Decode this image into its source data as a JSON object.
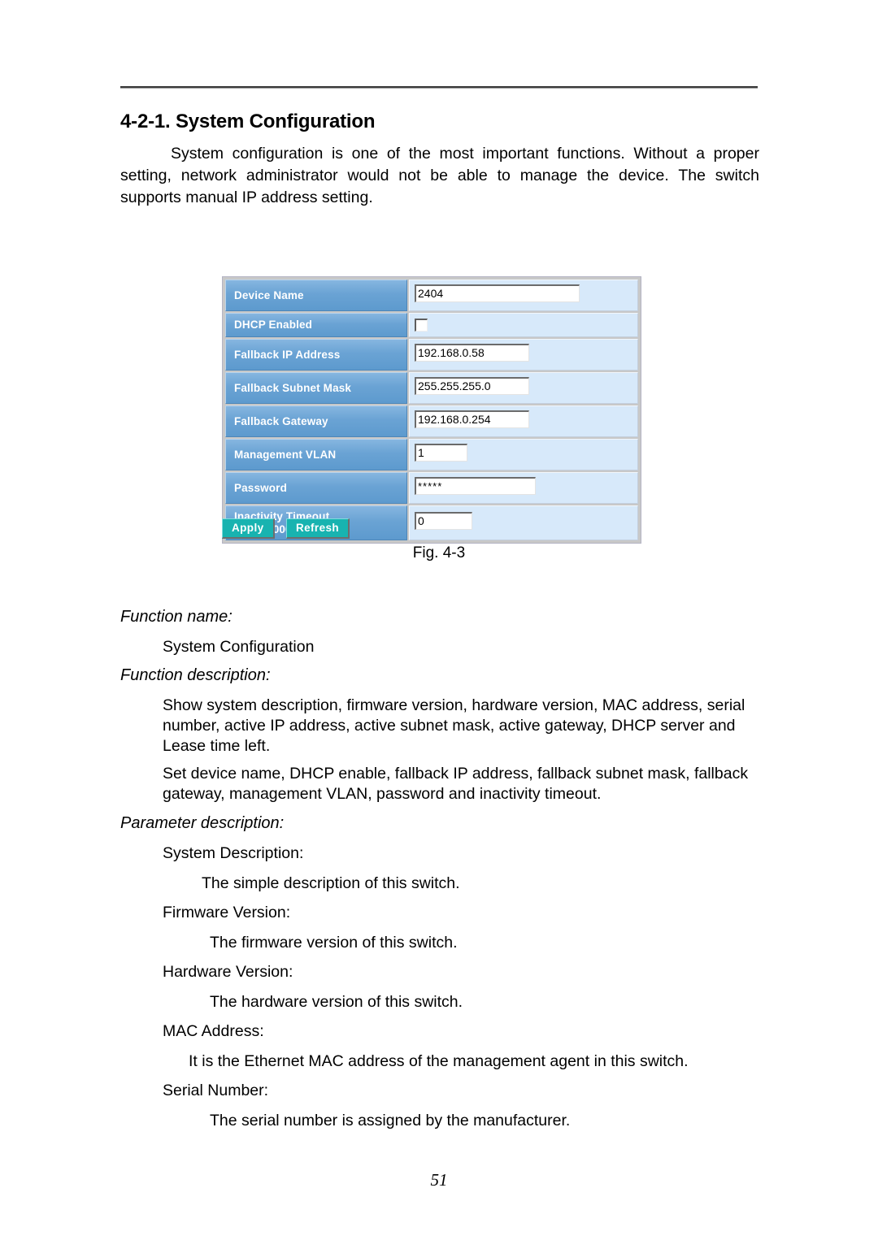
{
  "document": {
    "heading": "4-2-1. System Configuration",
    "intro": "System configuration is one of the most important functions. Without a proper setting, network administrator would not be able to manage the device. The switch supports manual IP address setting.",
    "figure_caption": "Fig. 4-3",
    "page_number": "51"
  },
  "screenshot": {
    "rows": [
      {
        "label": "Device Name",
        "value": "2404",
        "control": "text",
        "width": "w-device"
      },
      {
        "label": "DHCP Enabled",
        "value": "",
        "control": "checkbox",
        "checked": false
      },
      {
        "label": "Fallback IP Address",
        "value": "192.168.0.58",
        "control": "text",
        "width": "w-ip"
      },
      {
        "label": "Fallback Subnet Mask",
        "value": "255.255.255.0",
        "control": "text",
        "width": "w-ip"
      },
      {
        "label": "Fallback Gateway",
        "value": "192.168.0.254",
        "control": "text",
        "width": "w-ip"
      },
      {
        "label": "Management VLAN",
        "value": "1",
        "control": "text",
        "width": "w-vlan"
      },
      {
        "label": "Password",
        "value": "*****",
        "control": "password",
        "width": "w-pass"
      },
      {
        "label": "Inactivity Timeout\n(0, 60-10000 Secs)",
        "value": "0",
        "control": "text",
        "width": "w-timeout"
      }
    ],
    "buttons": [
      {
        "label": "Apply"
      },
      {
        "label": "Refresh"
      }
    ],
    "colors": {
      "label_cell": "#6aa3d4",
      "value_cell": "#d7e9fa",
      "button": "#18b3b0",
      "label_text": "#ffffff"
    }
  },
  "sections": {
    "function_name_label": "Function name:",
    "function_name_value": "System Configuration",
    "function_description_label": "Function description:",
    "function_description_p1": "Show system description, firmware version, hardware version, MAC address, serial number, active IP address, active subnet mask, active gateway, DHCP server and Lease time left.",
    "function_description_p2": "Set device name, DHCP enable, fallback IP address, fallback subnet mask, fallback gateway, management VLAN, password and inactivity timeout.",
    "parameter_description_label": "Parameter description:",
    "parameters": [
      {
        "term": "System Description:",
        "definition": "The simple description of this switch."
      },
      {
        "term": "Firmware Version:",
        "definition": "The firmware version of this switch."
      },
      {
        "term": "Hardware Version:",
        "definition": "The hardware version of this switch."
      },
      {
        "term": "MAC Address:",
        "definition": "It is the Ethernet MAC address of the management agent in this switch."
      },
      {
        "term": "Serial Number:",
        "definition": "The serial number is assigned by the manufacturer."
      }
    ]
  }
}
